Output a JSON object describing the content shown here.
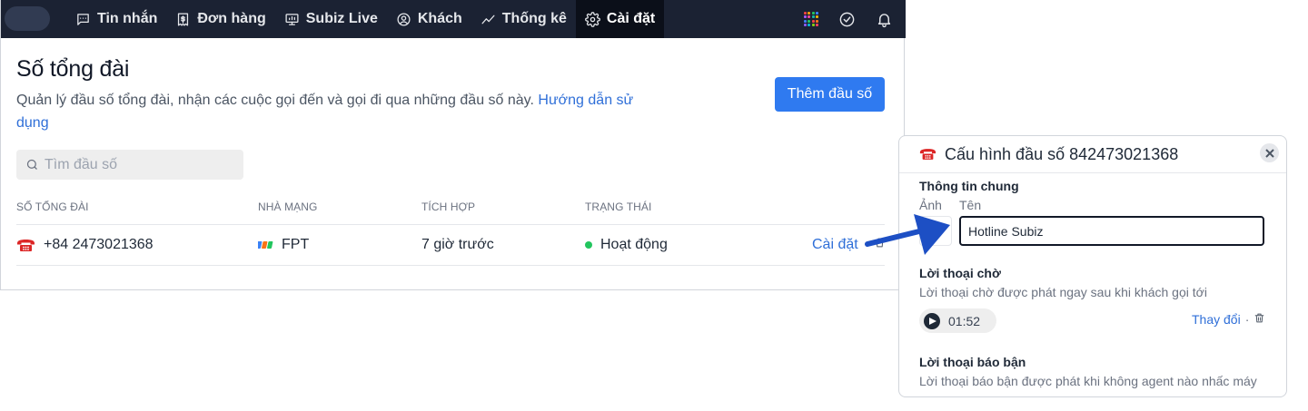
{
  "nav": {
    "items": [
      {
        "label": "Tin nhắn",
        "icon": "message-icon"
      },
      {
        "label": "Đơn hàng",
        "icon": "receipt-icon"
      },
      {
        "label": "Subiz Live",
        "icon": "monitor-icon"
      },
      {
        "label": "Khách",
        "icon": "user-circle-icon"
      },
      {
        "label": "Thống kê",
        "icon": "chart-line-icon"
      },
      {
        "label": "Cài đặt",
        "icon": "gear-icon",
        "active": true
      }
    ],
    "right_icons": [
      "apps-grid-icon",
      "check-circle-icon",
      "bell-icon"
    ]
  },
  "page": {
    "title": "Số tổng đài",
    "description": "Quản lý đầu số tổng đài, nhận các cuộc gọi đến và gọi đi qua những đầu số này.",
    "help_link": "Hướng dẫn sử dụng",
    "add_button": "Thêm đầu số"
  },
  "search": {
    "placeholder": "Tìm đầu số"
  },
  "table": {
    "headers": [
      "SỐ TỔNG ĐÀI",
      "NHÀ MẠNG",
      "TÍCH HỢP",
      "TRẠNG THÁI"
    ],
    "rows": [
      {
        "number": "+84 2473021368",
        "carrier": "FPT",
        "integrated": "7 giờ trước",
        "status": "Hoạt động",
        "action": "Cài đặt",
        "separator": "·"
      }
    ]
  },
  "panel": {
    "title": "Cấu hình đầu số 842473021368",
    "general_title": "Thông tin chung",
    "photo_label": "Ảnh",
    "name_label": "Tên",
    "name_value": "Hotline Subiz",
    "wait_title": "Lời thoại chờ",
    "wait_desc": "Lời thoại chờ được phát ngay sau khi khách gọi tới",
    "wait_duration": "01:52",
    "change_link": "Thay đổi",
    "separator": "·",
    "busy_title": "Lời thoại báo bận",
    "busy_desc": "Lời thoại báo bận được phát khi không agent nào nhấc máy"
  },
  "colors": {
    "topbar": "#1b2233",
    "accent": "#2f7af0",
    "link": "#2f6fd8",
    "status_active": "#22c55e",
    "arrow": "#1d4fc4",
    "phone_icon": "#dc2626"
  }
}
